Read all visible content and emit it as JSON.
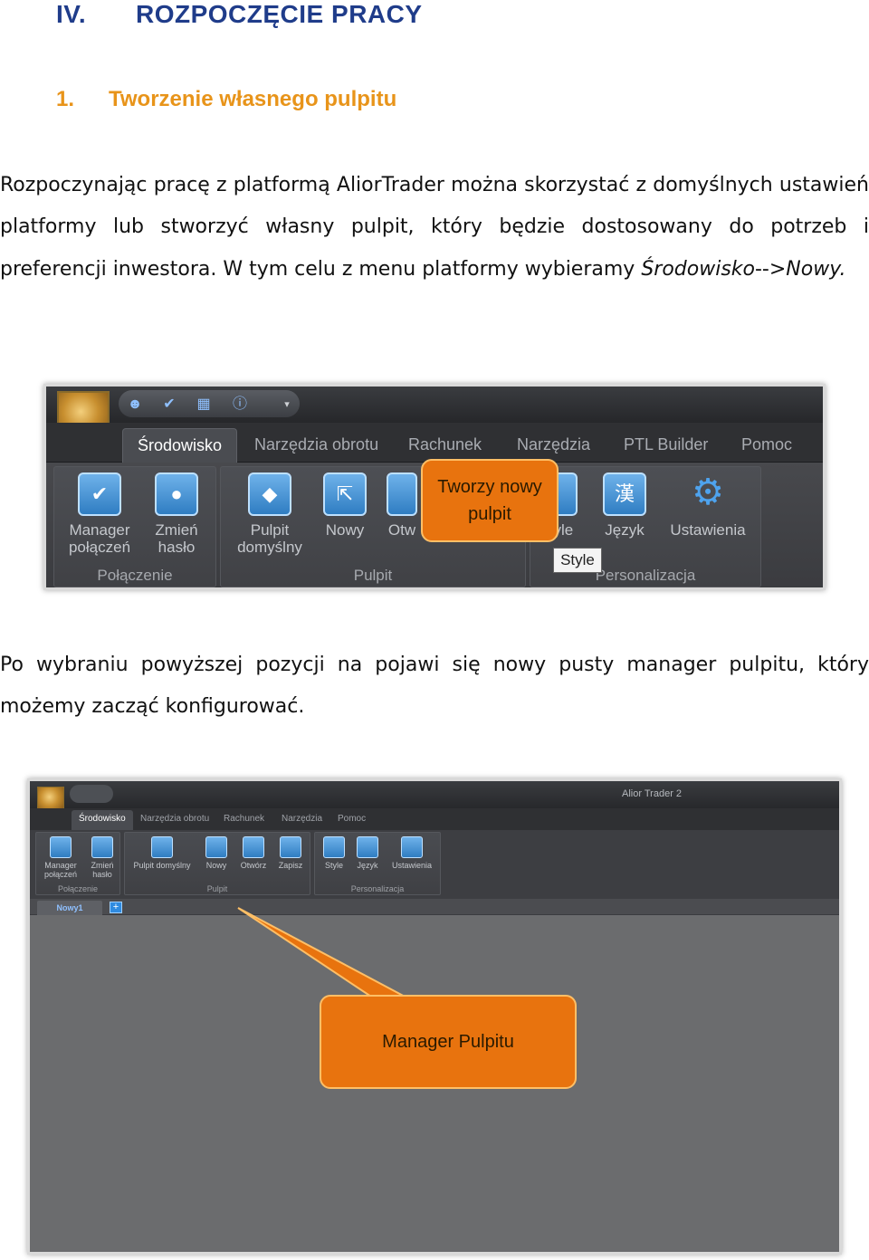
{
  "heading": {
    "number": "IV.",
    "title": "ROZPOCZĘCIE PRACY"
  },
  "subheading": {
    "number": "1.",
    "title": "Tworzenie własnego pulpitu"
  },
  "paragraph1": {
    "text": "Rozpoczynając pracę z platformą AliorTrader można skorzystać z domyślnych ustawień platformy lub stworzyć własny pulpit, który będzie dostosowany do potrzeb i preferencji inwestora. W tym celu z menu platformy wybieramy ",
    "menu_path": "Środowisko",
    "arrow": "-->",
    "menu_item": "Nowy",
    "end": "."
  },
  "paragraph2": "Po wybraniu powyższej pozycji na pojawi się nowy pusty manager pulpitu, który możemy zacząć konfigurować.",
  "screenshot1": {
    "tabs": [
      "Środowisko",
      "Narzędzia obrotu",
      "Rachunek",
      "Narzędzia",
      "PTL Builder",
      "Pomoc"
    ],
    "groups": {
      "polaczenie": "Połączenie",
      "pulpit": "Pulpit",
      "personalizacja": "Personalizacja"
    },
    "buttons": {
      "manager": "Manager\npołączeń",
      "zmien": "Zmień\nhasło",
      "pulpit_domyslny": "Pulpit\ndomyślny",
      "nowy": "Nowy",
      "otworz": "Otw",
      "style": "tyle",
      "jezyk": "Język",
      "ustawienia": "Ustawienia"
    },
    "callout": "Tworzy nowy\npulpit",
    "tooltip": "Style"
  },
  "screenshot2": {
    "app_title": "Alior Trader 2",
    "tabs": [
      "Środowisko",
      "Narzędzia obrotu",
      "Rachunek",
      "Narzędzia",
      "Pomoc"
    ],
    "groups": {
      "polaczenie": "Połączenie",
      "pulpit": "Pulpit",
      "personalizacja": "Personalizacja"
    },
    "buttons": {
      "manager": "Manager\npołączeń",
      "zmien": "Zmień\nhasło",
      "pulpit_domyslny": "Pulpit domyślny",
      "nowy": "Nowy",
      "otworz": "Otwórz",
      "zapisz": "Zapisz",
      "style": "Style",
      "jezyk": "Język",
      "ustawienia": "Ustawienia"
    },
    "doc_tab": "Nowy1",
    "plus": "+",
    "callout": "Manager Pulpitu"
  },
  "colors": {
    "heading": "#1f3c8a",
    "subheading": "#e8941a",
    "callout": "#e8730e"
  }
}
